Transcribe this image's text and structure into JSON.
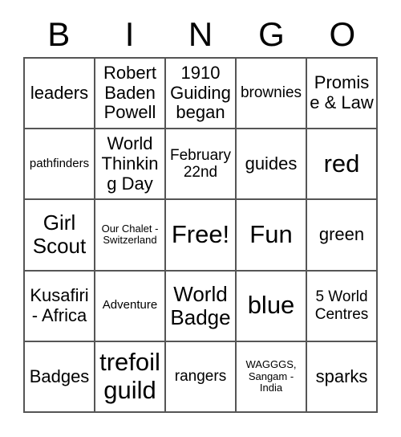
{
  "header": {
    "letters": [
      "B",
      "I",
      "N",
      "G",
      "O"
    ]
  },
  "grid": {
    "rows": [
      [
        {
          "text": "leaders",
          "size": "fs-lg"
        },
        {
          "text": "Robert Baden Powell",
          "size": "fs-lg"
        },
        {
          "text": "1910 Guiding began",
          "size": "fs-lg"
        },
        {
          "text": "brownies",
          "size": "fs-md"
        },
        {
          "text": "Promise & Law",
          "size": "fs-lg"
        }
      ],
      [
        {
          "text": "pathfinders",
          "size": "fs-sm"
        },
        {
          "text": "World Thinking Day",
          "size": "fs-lg"
        },
        {
          "text": "February 22nd",
          "size": "fs-md"
        },
        {
          "text": "guides",
          "size": "fs-lg"
        },
        {
          "text": "red",
          "size": "fs-xxl"
        }
      ],
      [
        {
          "text": "Girl Scout",
          "size": "fs-xl"
        },
        {
          "text": "Our Chalet - Switzerland",
          "size": "fs-xs"
        },
        {
          "text": "Free!",
          "size": "fs-xxl"
        },
        {
          "text": "Fun",
          "size": "fs-xxl"
        },
        {
          "text": "green",
          "size": "fs-lg"
        }
      ],
      [
        {
          "text": "Kusafiri - Africa",
          "size": "fs-lg"
        },
        {
          "text": "Adventure",
          "size": "fs-sm"
        },
        {
          "text": "World Badge",
          "size": "fs-xl"
        },
        {
          "text": "blue",
          "size": "fs-xxl"
        },
        {
          "text": "5 World Centres",
          "size": "fs-md"
        }
      ],
      [
        {
          "text": "Badges",
          "size": "fs-lg"
        },
        {
          "text": "trefoil guild",
          "size": "fs-xxl"
        },
        {
          "text": "rangers",
          "size": "fs-md"
        },
        {
          "text": "WAGGGS, Sangam - India",
          "size": "fs-xs"
        },
        {
          "text": "sparks",
          "size": "fs-lg"
        }
      ]
    ]
  }
}
